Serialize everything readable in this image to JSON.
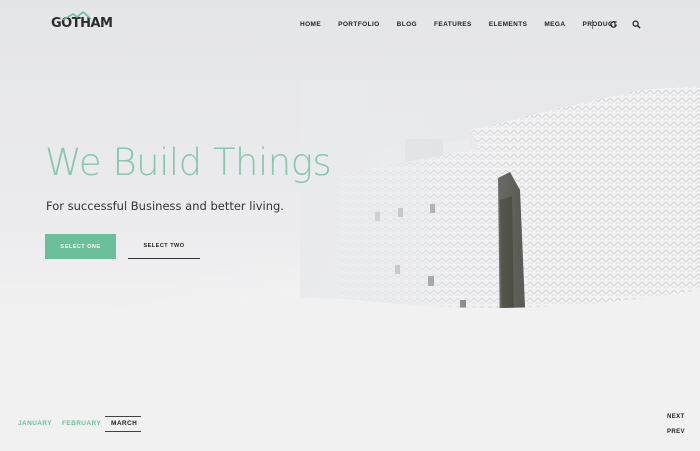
{
  "logo": {
    "text": "GOTHAM"
  },
  "nav": {
    "items": [
      "HOME",
      "PORTFOLIO",
      "BLOG",
      "FEATURES",
      "ELEMENTS",
      "MEGA",
      "PRODUCT"
    ]
  },
  "icons": {
    "refresh": "refresh-icon",
    "search": "search-icon"
  },
  "hero": {
    "title": "We Build Things",
    "subtitle": "For successful Business and better living.",
    "primary_button": "SELECT ONE",
    "secondary_button": "SELECT TWO"
  },
  "months": {
    "items": [
      "JANUARY",
      "FEBRUARY",
      "MARCH"
    ],
    "active": "MARCH"
  },
  "pager": {
    "next": "NEXT",
    "prev": "PREV"
  },
  "colors": {
    "accent": "#6cbf9b",
    "title": "#86c7ad",
    "text": "#222222"
  }
}
